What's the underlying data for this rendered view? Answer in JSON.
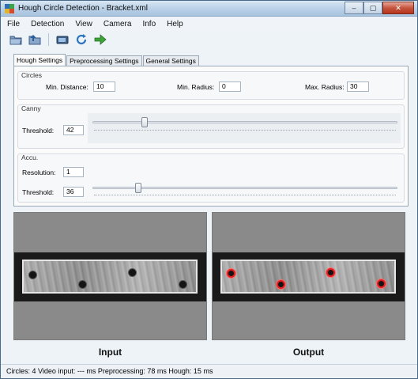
{
  "window": {
    "title": "Hough Circle Detection - Bracket.xml",
    "buttons": {
      "minimize": "–",
      "maximize": "▢",
      "close": "✕"
    }
  },
  "menu": [
    "File",
    "Detection",
    "View",
    "Camera",
    "Info",
    "Help"
  ],
  "toolbar": {
    "icons": [
      "open-folder-icon",
      "open-alt-icon",
      "camera-icon",
      "refresh-icon",
      "run-arrow-icon"
    ]
  },
  "tabs": [
    {
      "label": "Hough Settings",
      "active": true
    },
    {
      "label": "Preprocessing Settings",
      "active": false
    },
    {
      "label": "General Settings",
      "active": false
    }
  ],
  "circles": {
    "title": "Circles",
    "min_distance_label": "Min. Distance:",
    "min_distance_value": "10",
    "min_radius_label": "Min. Radius:",
    "min_radius_value": "0",
    "max_radius_label": "Max. Radius:",
    "max_radius_value": "30"
  },
  "canny": {
    "title": "Canny",
    "threshold_label": "Threshold:",
    "threshold_value": "42",
    "slider_level_percent": 17
  },
  "accu": {
    "title": "Accu.",
    "resolution_label": "Resolution:",
    "resolution_value": "1",
    "threshold_label": "Threshold:",
    "threshold_value": "36",
    "slider_level_percent": 15
  },
  "images": {
    "input_caption": "Input",
    "output_caption": "Output",
    "detected_circle_color": "#e0201f"
  },
  "status": {
    "text": "Circles:  4   Video input:  --- ms   Preprocessing:  78 ms   Hough:  15 ms"
  }
}
